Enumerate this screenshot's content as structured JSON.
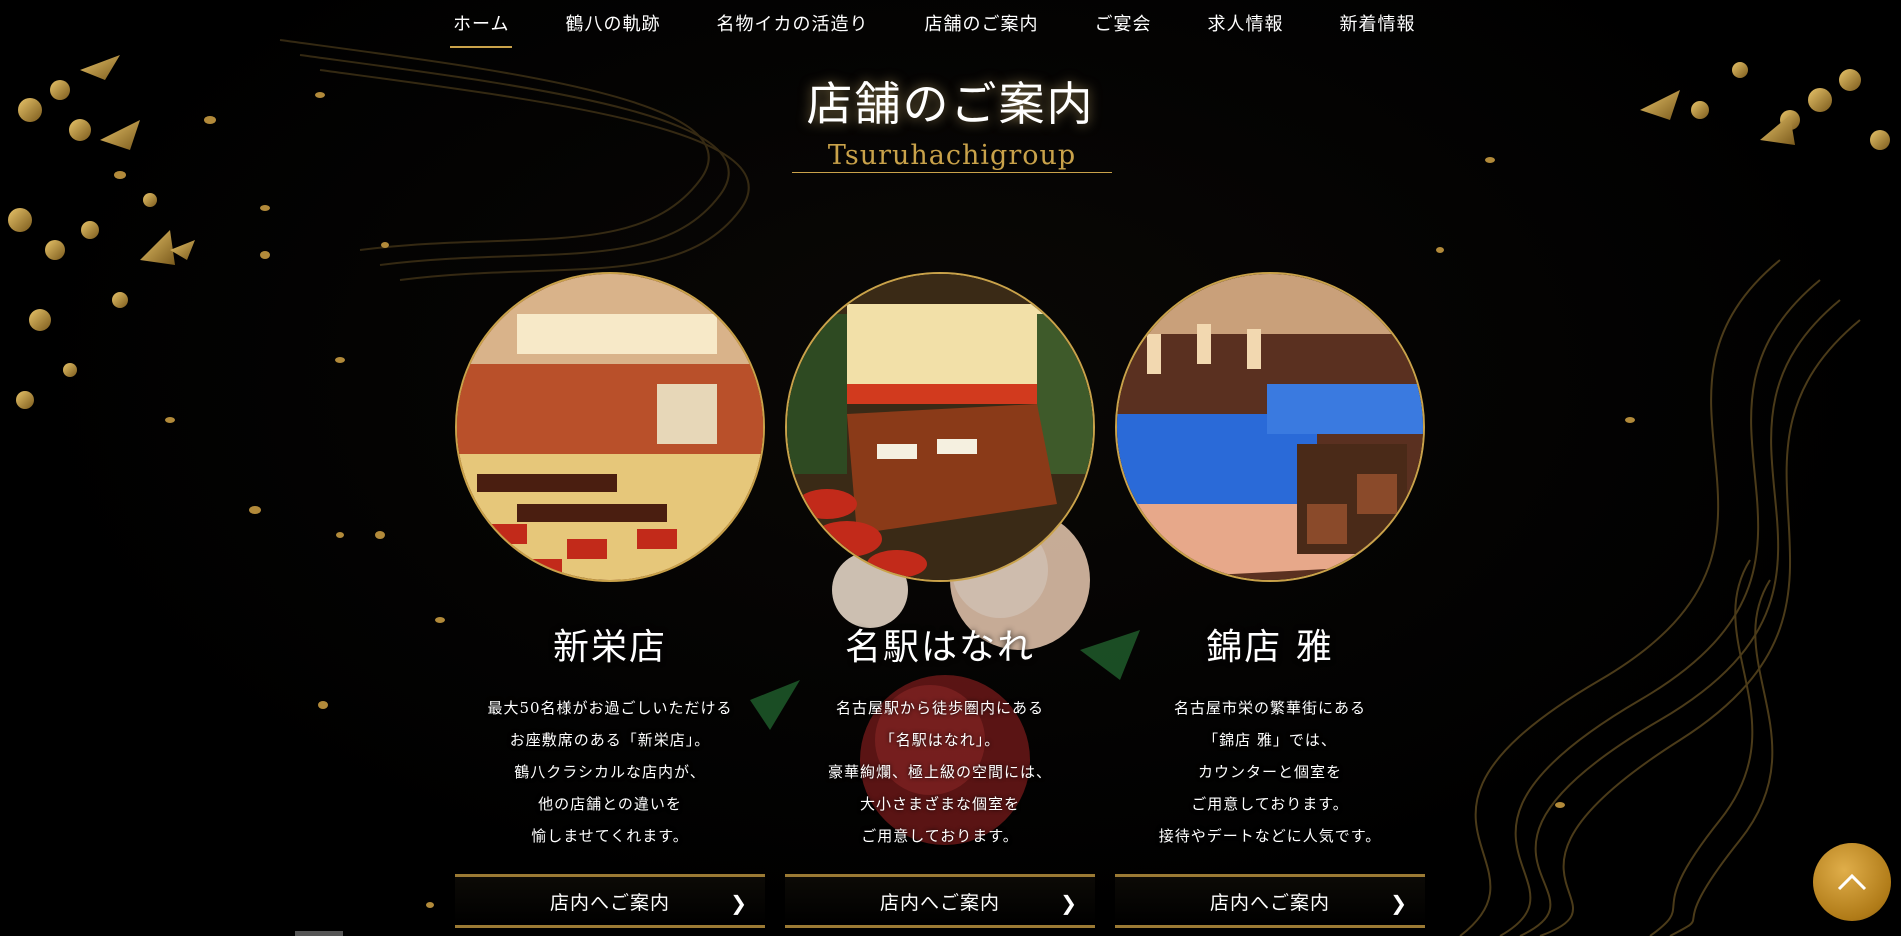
{
  "nav": {
    "items": [
      {
        "label": "ホーム",
        "active": true
      },
      {
        "label": "鶴八の軌跡"
      },
      {
        "label": "名物イカの活造り"
      },
      {
        "label": "店舗のご案内"
      },
      {
        "label": "ご宴会"
      },
      {
        "label": "求人情報"
      },
      {
        "label": "新着情報"
      }
    ]
  },
  "section": {
    "title": "店舗のご案内",
    "subtitle": "Tsuruhachigroup"
  },
  "stores": [
    {
      "name": "新栄店",
      "desc": [
        "最大50名様がお過ごしいただける",
        "お座敷席のある「新栄店」。",
        "鶴八クラシカルな店内が、",
        "他の店舗との違いを",
        "愉しませてくれます。"
      ],
      "button": "店内へご案内"
    },
    {
      "name": "名駅はなれ",
      "desc": [
        "名古屋駅から徒歩圏内にある",
        "「名駅はなれ」。",
        "豪華絢爛、極上級の空間には、",
        "大小さまざまな個室を",
        "ご用意しております。"
      ],
      "button": "店内へご案内"
    },
    {
      "name": "錦店 雅",
      "desc": [
        "名古屋市栄の繁華街にある",
        "「錦店 雅」では、",
        "カウンターと個室を",
        "ご用意しております。",
        "接待やデートなどに人気です。"
      ],
      "button": "店内へご案内"
    }
  ],
  "icons": {
    "to_top": "chevron-up-icon",
    "button_arrow": "chevron-right-icon"
  },
  "colors": {
    "gold": "#c9a24a",
    "background": "#000000"
  }
}
